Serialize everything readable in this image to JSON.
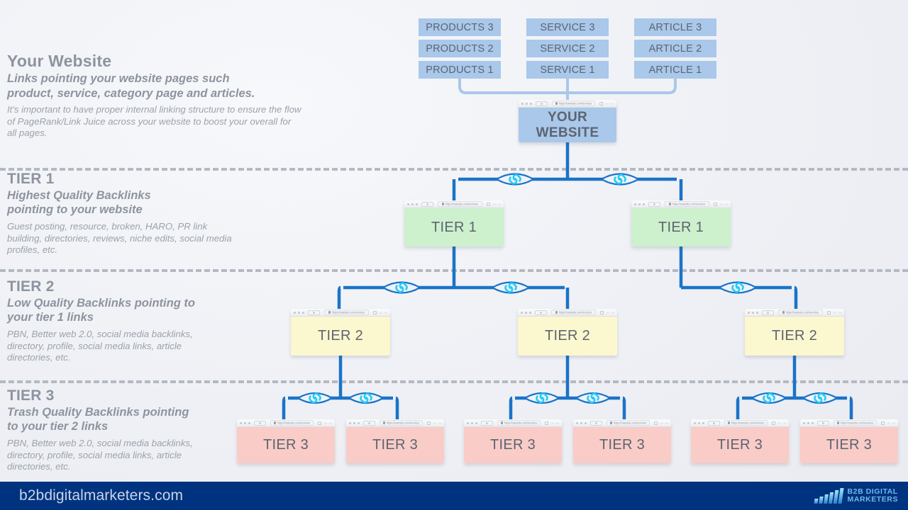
{
  "sections": [
    {
      "title": "Your Website",
      "subtitle": "Links pointing your website pages such product, service, category page and articles.",
      "body": "It's important to have proper internal linking structure to ensure the flow of PageRank/Link Juice across your website to boost your overall for all pages."
    },
    {
      "title": "TIER 1",
      "subtitle": "Highest Quality Backlinks pointing to your website",
      "body": "Guest posting, resource, broken, HARO, PR link building, directories, reviews, niche edits, social media profiles, etc."
    },
    {
      "title": "TIER 2",
      "subtitle": "Low Quality Backlinks pointing to your tier 1 links",
      "body": "PBN, Better web 2.0, social media backlinks, directory, profile, social media links, article directories, etc."
    },
    {
      "title": "TIER 3",
      "subtitle": "Trash Quality Backlinks pointing to your tier 2 links",
      "body": "PBN, Better web 2.0, social media backlinks, directory, profile, social media links, article directories, etc."
    }
  ],
  "page_pills": [
    {
      "label": "PRODUCTS 3"
    },
    {
      "label": "SERVICE 3"
    },
    {
      "label": "ARTICLE 3"
    },
    {
      "label": "PRODUCTS 2"
    },
    {
      "label": "SERVICE 2"
    },
    {
      "label": "ARTICLE 2"
    },
    {
      "label": "PRODUCTS 1"
    },
    {
      "label": "SERVICE 1"
    },
    {
      "label": "ARTICLE 1"
    }
  ],
  "website_node": {
    "line1": "YOUR",
    "line2": "WEBSITE"
  },
  "tier1_nodes": [
    {
      "label": "TIER 1"
    },
    {
      "label": "TIER 1"
    }
  ],
  "tier2_nodes": [
    {
      "label": "TIER 2"
    },
    {
      "label": "TIER 2"
    },
    {
      "label": "TIER 2"
    }
  ],
  "tier3_nodes": [
    {
      "label": "TIER 3"
    },
    {
      "label": "TIER 3"
    },
    {
      "label": "TIER 3"
    },
    {
      "label": "TIER 3"
    },
    {
      "label": "TIER 3"
    },
    {
      "label": "TIER 3"
    }
  ],
  "browser_chrome": {
    "url": "https://example.com/services",
    "icon_lock": "lock-icon",
    "icon_reload": "reload-icon",
    "icon_navigate": "back-forward-icon"
  },
  "link_icon_name": "chain-link-icon",
  "footer": {
    "url": "b2bdigitalmarketers.com",
    "brand_line1": "B2B DIGITAL",
    "brand_line2": "MARKETERS",
    "logo_name": "bar-chart-logo"
  },
  "colors": {
    "background": "#eef0f5",
    "pill": "#a9c8ea",
    "tier1": "#cdf0cd",
    "tier2": "#fbf7ce",
    "tier3": "#f9ccc8",
    "connector": "#1b73c8",
    "connector_light": "#a9c8ea",
    "link_glyph": "#22ccf5",
    "divider": "#b4bac4",
    "footer": "#00337f",
    "text_muted": "#8d949f"
  }
}
